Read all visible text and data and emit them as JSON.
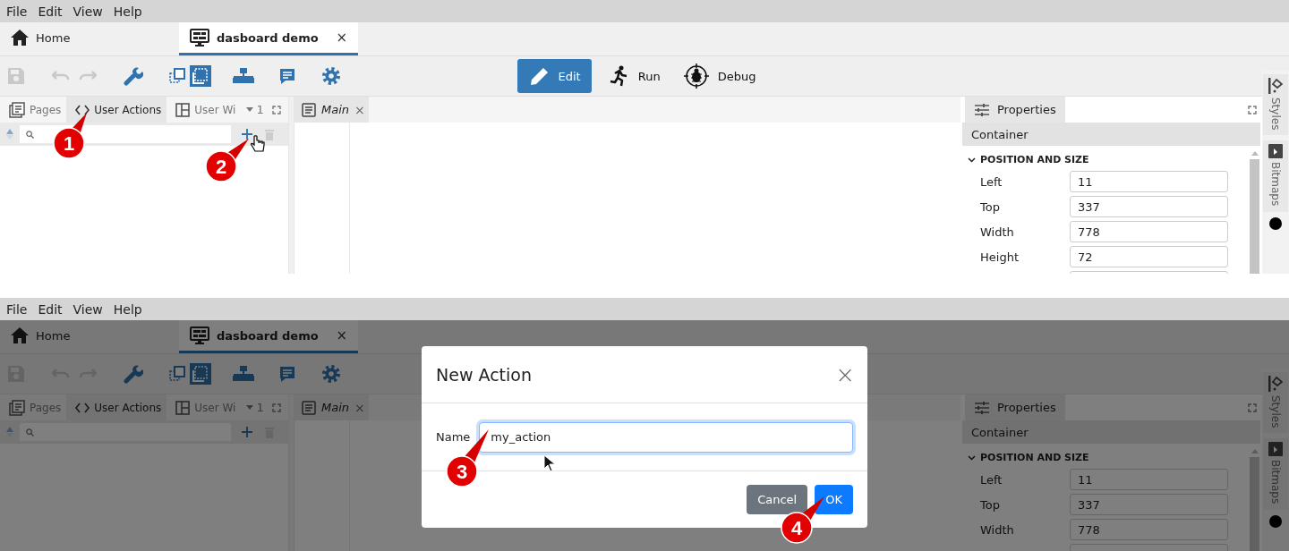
{
  "screenshots": [
    {
      "menu": [
        {
          "label": "File"
        },
        {
          "label": "Edit"
        },
        {
          "label": "View"
        },
        {
          "label": "Help"
        }
      ],
      "doc_tabs": [
        {
          "label": "Home",
          "selected": false
        },
        {
          "label": "dasboard demo",
          "selected": true,
          "close": "×"
        }
      ],
      "modes": [
        {
          "label": "Edit",
          "selected": true
        },
        {
          "label": "Run",
          "selected": false
        },
        {
          "label": "Debug",
          "selected": false
        }
      ],
      "left_tabs": [
        {
          "label": "Pages",
          "selected": false
        },
        {
          "label": "User Actions",
          "selected": true
        },
        {
          "label": "User Wi",
          "selected": false,
          "count": "1"
        }
      ],
      "editor_tabs": [
        {
          "label": "Main",
          "close": "×"
        }
      ],
      "properties": {
        "tab": "Properties",
        "object": "Container",
        "section": {
          "label": "POSITION AND SIZE",
          "expanded": true
        },
        "fields": [
          {
            "label": "Left",
            "value": "11"
          },
          {
            "label": "Top",
            "value": "337"
          },
          {
            "label": "Width",
            "value": "778"
          },
          {
            "label": "Height",
            "value": "72"
          }
        ]
      },
      "side_tabs": [
        {
          "label": "Styles"
        },
        {
          "label": "Bitmaps"
        }
      ],
      "callouts": [
        {
          "number": "1"
        },
        {
          "number": "2"
        }
      ]
    },
    {
      "menu": [
        {
          "label": "File"
        },
        {
          "label": "Edit"
        },
        {
          "label": "View"
        },
        {
          "label": "Help"
        }
      ],
      "doc_tabs": [
        {
          "label": "Home",
          "selected": false
        },
        {
          "label": "dasboard demo",
          "selected": true,
          "close": "×"
        }
      ],
      "left_tabs": [
        {
          "label": "Pages",
          "selected": false
        },
        {
          "label": "User Actions",
          "selected": true
        },
        {
          "label": "User Wi",
          "selected": false,
          "count": "1"
        }
      ],
      "editor_tabs": [
        {
          "label": "Main",
          "close": "×"
        }
      ],
      "properties": {
        "tab": "Properties",
        "object": "Container",
        "section": {
          "label": "POSITION AND SIZE",
          "expanded": true
        },
        "fields": [
          {
            "label": "Left",
            "value": "11"
          },
          {
            "label": "Top",
            "value": "337"
          },
          {
            "label": "Width",
            "value": "778"
          }
        ]
      },
      "side_tabs": [
        {
          "label": "Styles"
        },
        {
          "label": "Bitmaps"
        }
      ],
      "callouts": [
        {
          "number": "3"
        },
        {
          "number": "4"
        }
      ],
      "dialog": {
        "title": "New Action",
        "close": "×",
        "field_label": "Name",
        "field_value": "my_action",
        "buttons": [
          {
            "label": "Cancel",
            "kind": "secondary"
          },
          {
            "label": "OK",
            "kind": "primary"
          }
        ]
      }
    }
  ]
}
